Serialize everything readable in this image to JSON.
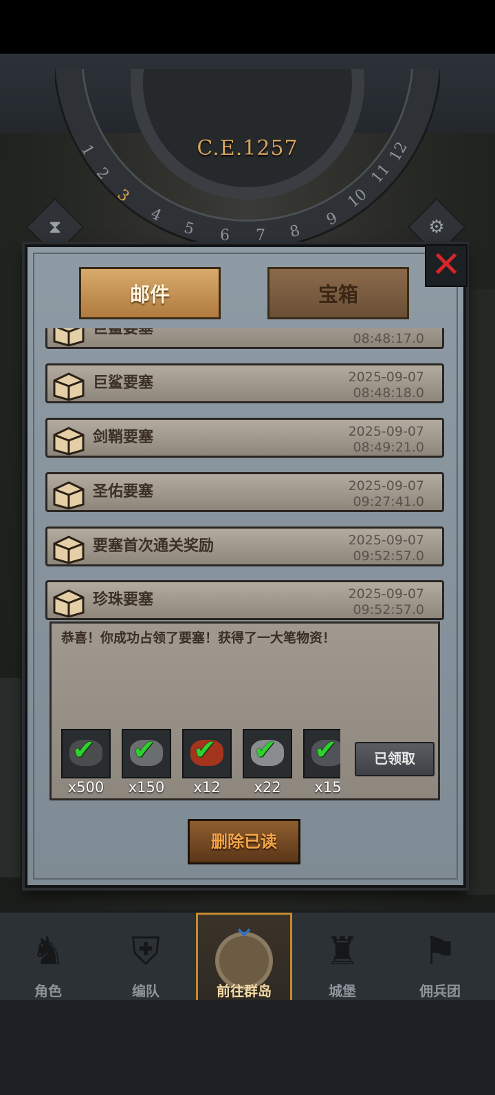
{
  "hud": {
    "year": "C.E.1257",
    "dial_numbers": [
      "1",
      "2",
      "3",
      "4",
      "5",
      "6",
      "7",
      "8",
      "9",
      "10",
      "11",
      "12"
    ],
    "current_month": "3",
    "left_icon": "hourglass-icon",
    "right_icon": "gear-icon"
  },
  "dialog": {
    "close_icon": "close-x-icon",
    "tabs": [
      {
        "label": "邮件",
        "active": true
      },
      {
        "label": "宝箱",
        "active": false
      }
    ],
    "mails": [
      {
        "title": "巨鲨要塞",
        "date": "",
        "time": "08:48:17.0",
        "icon": "chest-icon"
      },
      {
        "title": "巨鲨要塞",
        "date": "2025-09-07",
        "time": "08:48:18.0",
        "icon": "chest-icon"
      },
      {
        "title": "剑鞘要塞",
        "date": "2025-09-07",
        "time": "08:49:21.0",
        "icon": "chest-icon"
      },
      {
        "title": "圣佑要塞",
        "date": "2025-09-07",
        "time": "09:27:41.0",
        "icon": "chest-icon"
      },
      {
        "title": "要塞首次通关奖励",
        "date": "2025-09-07",
        "time": "09:52:57.0",
        "icon": "chest-icon"
      },
      {
        "title": "珍珠要塞",
        "date": "2025-09-07",
        "time": "09:52:57.0",
        "icon": "chest-icon"
      }
    ],
    "detail": {
      "message": "恭喜！你成功占领了要塞！获得了一大笔物资！",
      "claimed_label": "已领取",
      "rewards": [
        {
          "qty": "x500",
          "icon": "ore-icon",
          "color": "#4a4c4e"
        },
        {
          "qty": "x150",
          "icon": "stone-icon",
          "color": "#6b6e70"
        },
        {
          "qty": "x12",
          "icon": "berries-icon",
          "color": "#a3351c"
        },
        {
          "qty": "x22",
          "icon": "cannonball-icon",
          "color": "#8a8d90"
        },
        {
          "qty": "x15",
          "icon": "armor-icon",
          "color": "#505458"
        }
      ]
    },
    "delete_label": "删除已读"
  },
  "nav": {
    "items": [
      {
        "label": "角色",
        "icon": "knight-icon",
        "active": false
      },
      {
        "label": "编队",
        "icon": "helmet-icon",
        "active": false
      },
      {
        "label": "前往群岛",
        "icon": "globe-icon",
        "active": true
      },
      {
        "label": "城堡",
        "icon": "castle-icon",
        "active": false
      },
      {
        "label": "佣兵团",
        "icon": "banner-icon",
        "active": false
      }
    ]
  },
  "colors": {
    "accent_gold": "#c58a2d",
    "check_green": "#2fd12f",
    "close_red": "#d6262a"
  }
}
